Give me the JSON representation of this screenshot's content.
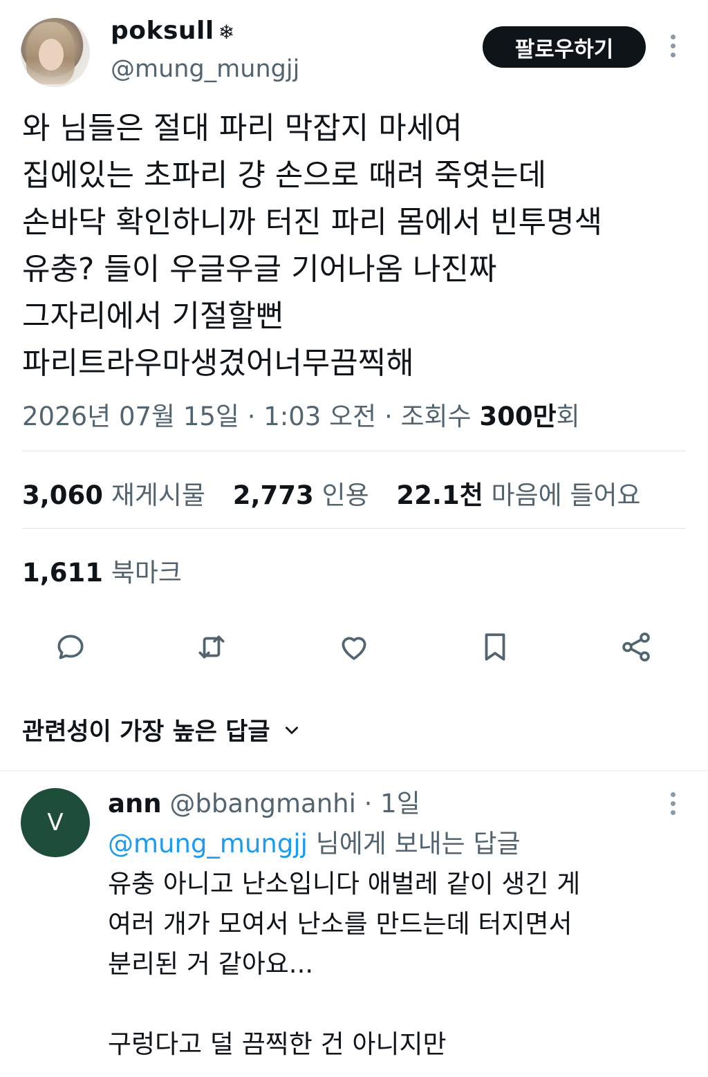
{
  "tweet": {
    "display_name": "poksull",
    "name_badge": "❄",
    "handle": "@mung_mungjj",
    "follow_label": "팔로우하기",
    "lines": [
      "와 님들은 절대 파리 막잡지 마세여",
      "집에있는 초파리 걍 손으로 때려 죽엿는데",
      "손바닥 확인하니까 터진 파리 몸에서 빈투명색",
      "유충? 들이 우글우글 기어나옴 나진짜",
      "그자리에서 기절할뻔",
      "파리트라우마생겼어너무끔찍해"
    ],
    "meta_prefix": "2026년 07월 15일 · 1:03 오전 · 조회수 ",
    "views_value": "300만",
    "views_suffix": "회"
  },
  "stats": {
    "reposts_count": "3,060",
    "reposts_label": "재게시물",
    "quotes_count": "2,773",
    "quotes_label": "인용",
    "likes_count": "22.1천",
    "likes_label": "마음에 들어요",
    "bookmarks_count": "1,611",
    "bookmarks_label": "북마크"
  },
  "actions": [
    "reply-icon",
    "repost-icon",
    "like-icon",
    "bookmark-icon",
    "share-icon"
  ],
  "replies_section": {
    "sort_label": "관련성이 가장 높은 답글"
  },
  "reply": {
    "avatar_letter": "V",
    "name": "ann",
    "handle_time": "@bbangmanhi · 1일",
    "mention": "@mung_mungjj",
    "reply_suffix": "님에게 보내는 답글",
    "lines": [
      "유충 아니고 난소입니다 애벌레 같이 생긴 게",
      "여러 개가 모여서 난소를 만드는데 터지면서",
      "분리된 거 같아요...",
      "",
      "구렁다고 덜 끔찍한 건 아니지만"
    ]
  },
  "colors": {
    "text": "#0f1419",
    "secondary": "#536471",
    "link": "#1d9bf0",
    "button_bg": "#0f1419",
    "reply_avatar_bg": "#1e4d3a"
  }
}
